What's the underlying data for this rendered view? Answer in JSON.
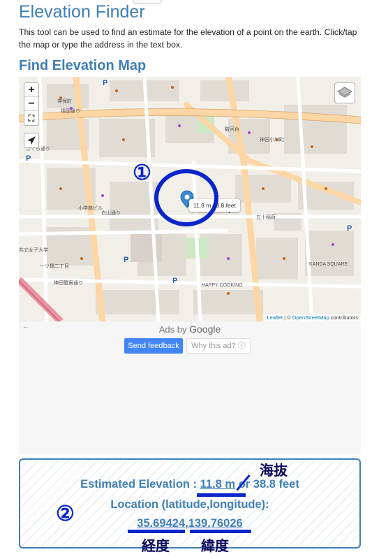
{
  "header": {
    "title": "Elevation Finder",
    "intro": "This tool can be used to find an estimate for the elevation of a point on the earth. Click/tap the map or type the address in the text box.",
    "section_title": "Find Elevation Map"
  },
  "map": {
    "popup_text": "11.8 m 38.8 feet",
    "zoom_in": "+",
    "zoom_out": "−",
    "attribution_leaflet": "Leaflet",
    "attribution_sep": " | © ",
    "attribution_osm": "OpenStreetMap",
    "attribution_tail": " contributors",
    "labels": [
      {
        "text": "靖国通り"
      },
      {
        "text": "神保町"
      },
      {
        "text": "さくら通り"
      },
      {
        "text": "駿河台"
      },
      {
        "text": "神田小川町"
      },
      {
        "text": "一ツ橋二丁目"
      },
      {
        "text": "白山通り"
      },
      {
        "text": "神田警察通り"
      },
      {
        "text": "KANDA SQUARE"
      },
      {
        "text": "小学館ビル"
      },
      {
        "text": "共立女子大学"
      },
      {
        "text": "五十稲荷"
      },
      {
        "text": "HAPPY COOKING"
      }
    ]
  },
  "annotations": {
    "num1": "①",
    "num2": "②",
    "kaibatsu": "海抜",
    "keido": "経度",
    "ido": "緯度"
  },
  "ads": {
    "arrow": "←",
    "ads_by": "Ads by",
    "google": "Google",
    "feedback": "Send feedback",
    "why": "Why this ad? ⓘ"
  },
  "result": {
    "elev_label": "Estimated Elevation : ",
    "elev_m": "11.8 m",
    "elev_or": " or ",
    "elev_ft": "38.8 feet",
    "loc_label": "Location (latitude,longitude):",
    "lat": "35.69424",
    "comma": ",",
    "lng": "139.76026"
  },
  "colors": {
    "brand": "#3f7fb5",
    "annotation": "#0a25c9",
    "feedback_button": "#4285f4"
  }
}
